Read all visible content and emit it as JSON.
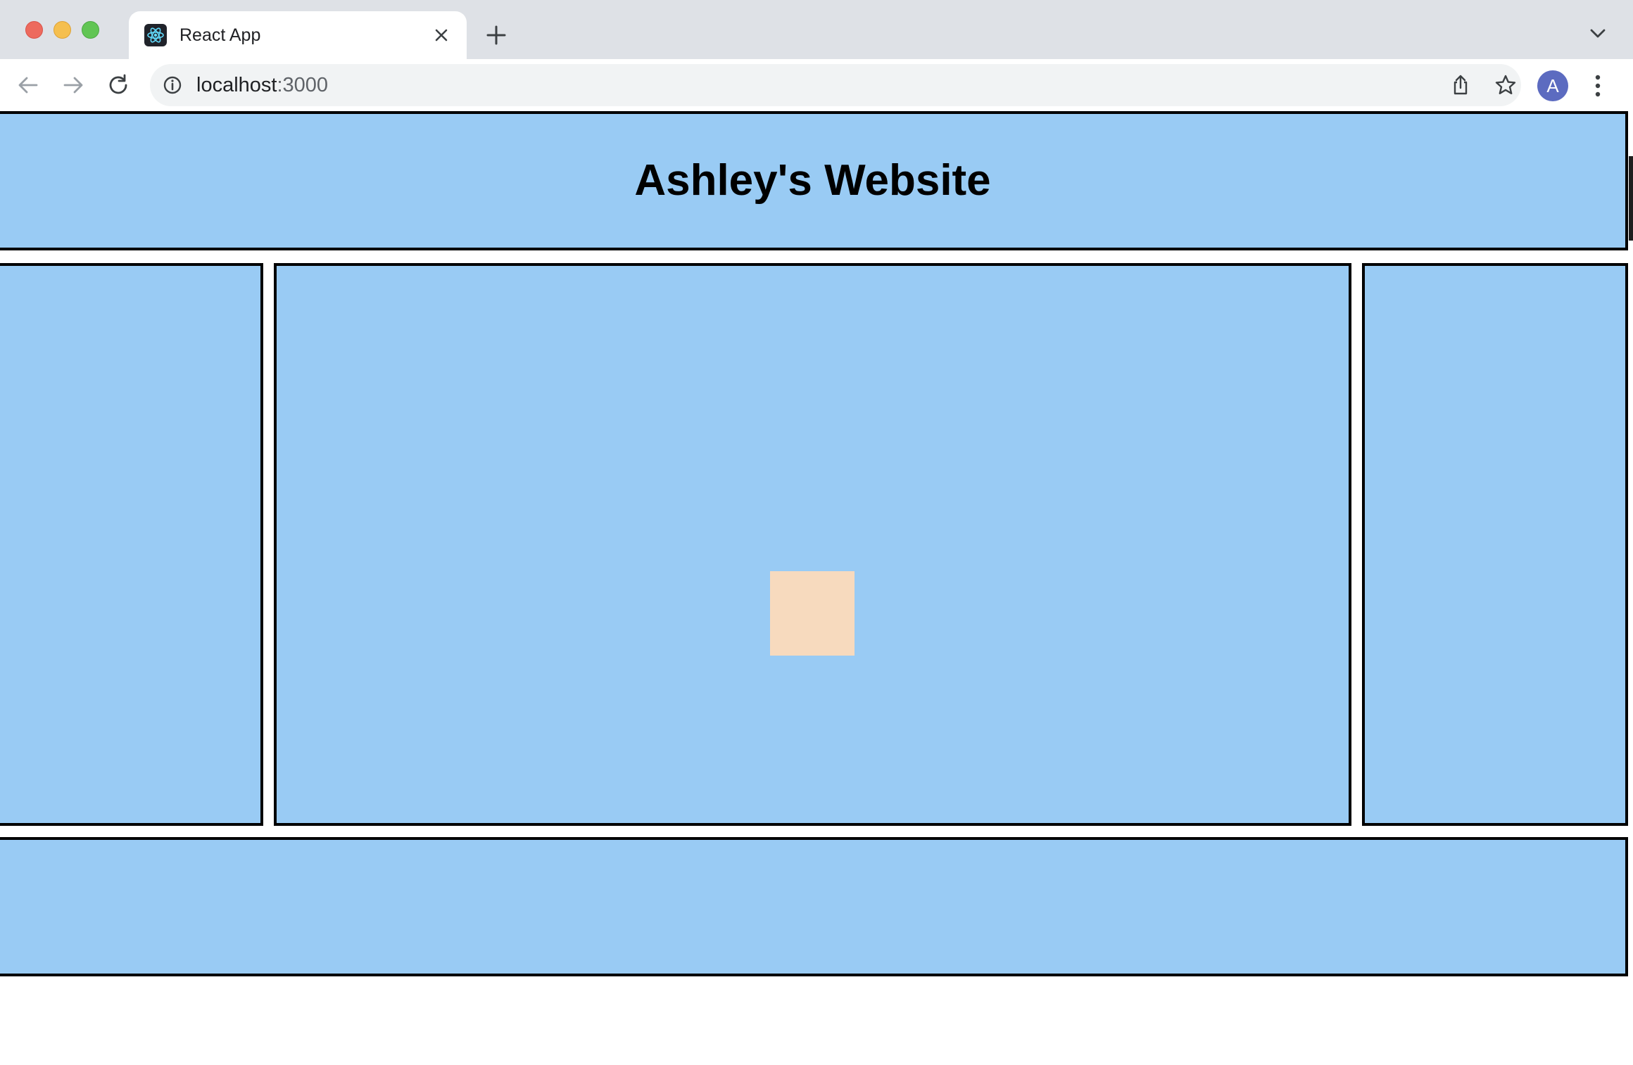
{
  "browser": {
    "tab": {
      "title": "React App"
    },
    "address_bar": {
      "host": "localhost",
      "port": ":3000"
    },
    "profile": {
      "initial": "A",
      "color": "#5c6bc0"
    },
    "icons": [
      "react-favicon-icon",
      "close-icon",
      "plus-icon",
      "chevron-down-icon",
      "back-arrow-icon",
      "forward-arrow-icon",
      "reload-icon",
      "info-icon",
      "share-icon",
      "star-icon",
      "kebab-menu-icon"
    ]
  },
  "page": {
    "header": {
      "title": "Ashley's Website"
    },
    "colors": {
      "panel_background": "#99cbf4",
      "panel_border": "#000000",
      "center_box": "#f7dabe"
    }
  }
}
